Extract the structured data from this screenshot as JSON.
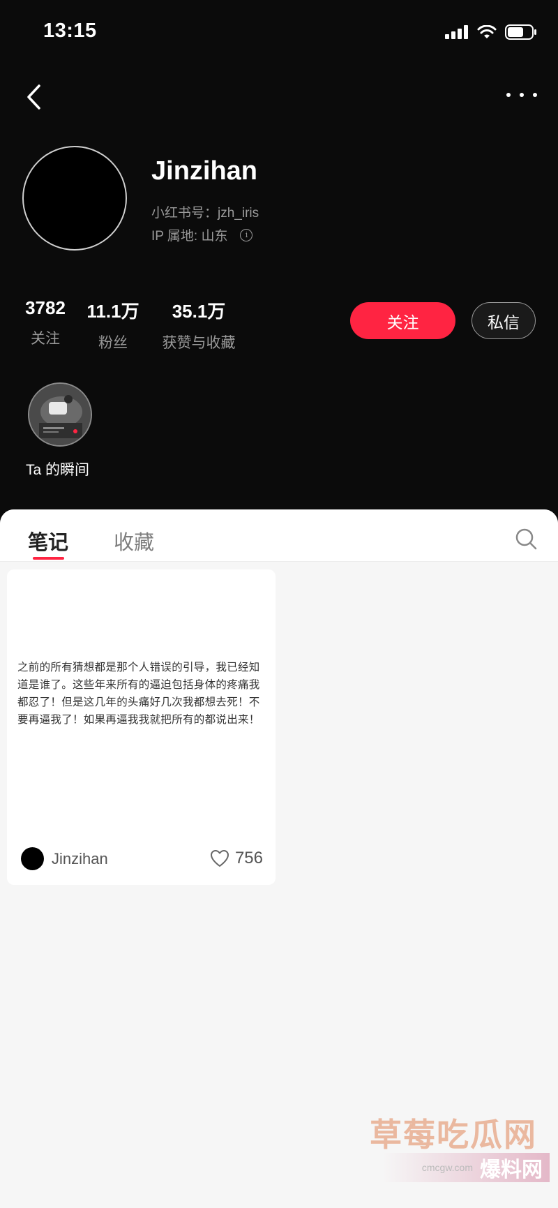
{
  "status_bar": {
    "time": "13:15"
  },
  "profile": {
    "name": "Jinzihan",
    "redid": "小红书号：jzh_iris",
    "ip": "IP 属地: 山东"
  },
  "stats": [
    {
      "value": "3782",
      "label": "关注"
    },
    {
      "value": "11.1万",
      "label": "粉丝"
    },
    {
      "value": "35.1万",
      "label": "获赞与收藏"
    }
  ],
  "actions": {
    "follow": "关注",
    "message": "私信"
  },
  "moments": {
    "label": "Ta 的瞬间"
  },
  "tabs": [
    {
      "label": "笔记",
      "active": true
    },
    {
      "label": "收藏",
      "active": false
    }
  ],
  "note": {
    "text": "之前的所有猜想都是那个人错误的引导，我已经知道是谁了。这些年来所有的逼迫包括身体的疼痛我都忍了！但是这几年的头痛好几次我都想去死！不要再逼我了！如果再逼我我就把所有的都说出来！",
    "author": "Jinzihan",
    "likes": "756"
  },
  "watermark": {
    "main": "草莓吃瓜网",
    "url": "cmcgw.com",
    "sub": "爆料网"
  },
  "colors": {
    "accent": "#ff2442",
    "background": "#0b0b0b",
    "sheet": "#f6f6f6"
  },
  "icons": [
    "back-icon",
    "more-icon",
    "signal-icon",
    "wifi-icon",
    "battery-icon",
    "info-icon",
    "search-icon",
    "heart-icon"
  ]
}
